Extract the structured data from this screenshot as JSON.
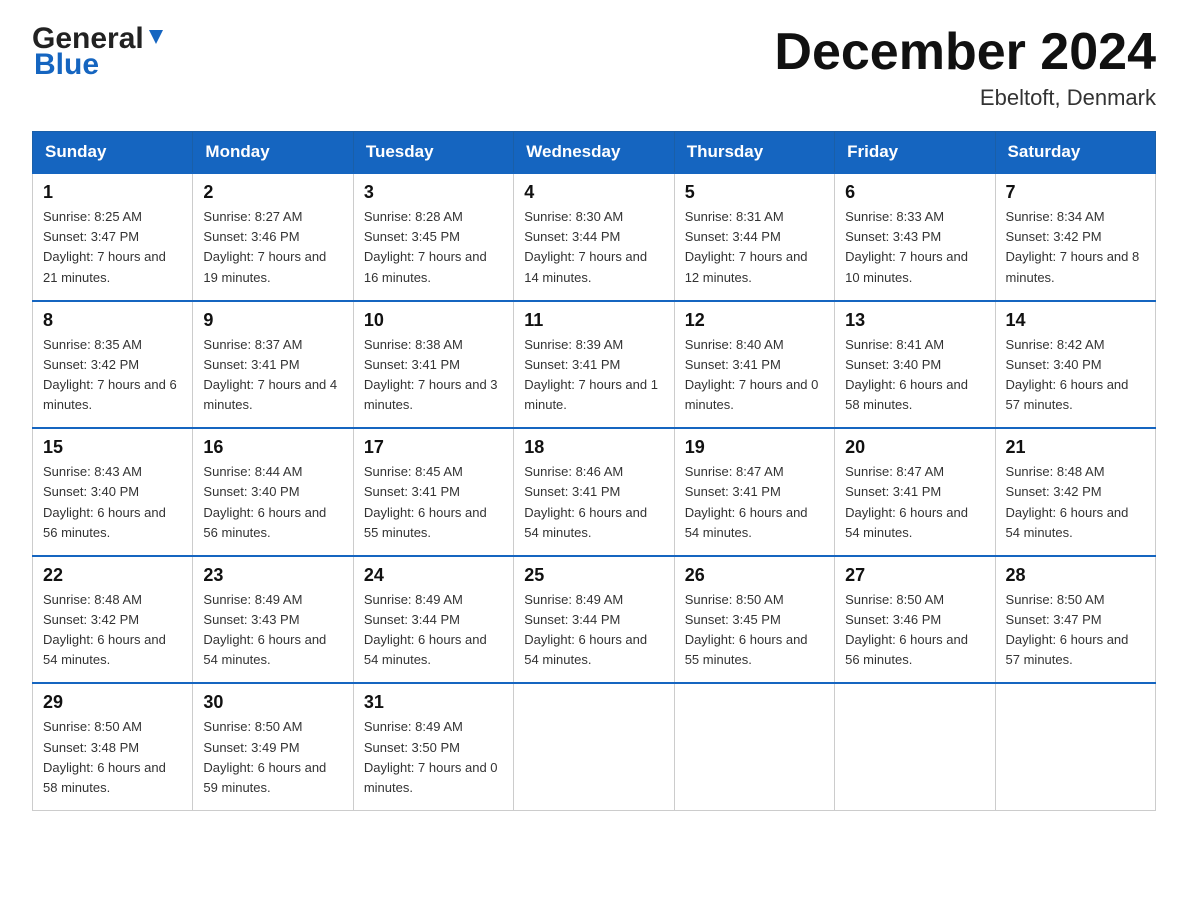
{
  "header": {
    "logo_general": "General",
    "logo_blue": "Blue",
    "title": "December 2024",
    "subtitle": "Ebeltoft, Denmark"
  },
  "calendar": {
    "days_of_week": [
      "Sunday",
      "Monday",
      "Tuesday",
      "Wednesday",
      "Thursday",
      "Friday",
      "Saturday"
    ],
    "weeks": [
      [
        {
          "day": "1",
          "sunrise": "8:25 AM",
          "sunset": "3:47 PM",
          "daylight": "7 hours and 21 minutes."
        },
        {
          "day": "2",
          "sunrise": "8:27 AM",
          "sunset": "3:46 PM",
          "daylight": "7 hours and 19 minutes."
        },
        {
          "day": "3",
          "sunrise": "8:28 AM",
          "sunset": "3:45 PM",
          "daylight": "7 hours and 16 minutes."
        },
        {
          "day": "4",
          "sunrise": "8:30 AM",
          "sunset": "3:44 PM",
          "daylight": "7 hours and 14 minutes."
        },
        {
          "day": "5",
          "sunrise": "8:31 AM",
          "sunset": "3:44 PM",
          "daylight": "7 hours and 12 minutes."
        },
        {
          "day": "6",
          "sunrise": "8:33 AM",
          "sunset": "3:43 PM",
          "daylight": "7 hours and 10 minutes."
        },
        {
          "day": "7",
          "sunrise": "8:34 AM",
          "sunset": "3:42 PM",
          "daylight": "7 hours and 8 minutes."
        }
      ],
      [
        {
          "day": "8",
          "sunrise": "8:35 AM",
          "sunset": "3:42 PM",
          "daylight": "7 hours and 6 minutes."
        },
        {
          "day": "9",
          "sunrise": "8:37 AM",
          "sunset": "3:41 PM",
          "daylight": "7 hours and 4 minutes."
        },
        {
          "day": "10",
          "sunrise": "8:38 AM",
          "sunset": "3:41 PM",
          "daylight": "7 hours and 3 minutes."
        },
        {
          "day": "11",
          "sunrise": "8:39 AM",
          "sunset": "3:41 PM",
          "daylight": "7 hours and 1 minute."
        },
        {
          "day": "12",
          "sunrise": "8:40 AM",
          "sunset": "3:41 PM",
          "daylight": "7 hours and 0 minutes."
        },
        {
          "day": "13",
          "sunrise": "8:41 AM",
          "sunset": "3:40 PM",
          "daylight": "6 hours and 58 minutes."
        },
        {
          "day": "14",
          "sunrise": "8:42 AM",
          "sunset": "3:40 PM",
          "daylight": "6 hours and 57 minutes."
        }
      ],
      [
        {
          "day": "15",
          "sunrise": "8:43 AM",
          "sunset": "3:40 PM",
          "daylight": "6 hours and 56 minutes."
        },
        {
          "day": "16",
          "sunrise": "8:44 AM",
          "sunset": "3:40 PM",
          "daylight": "6 hours and 56 minutes."
        },
        {
          "day": "17",
          "sunrise": "8:45 AM",
          "sunset": "3:41 PM",
          "daylight": "6 hours and 55 minutes."
        },
        {
          "day": "18",
          "sunrise": "8:46 AM",
          "sunset": "3:41 PM",
          "daylight": "6 hours and 54 minutes."
        },
        {
          "day": "19",
          "sunrise": "8:47 AM",
          "sunset": "3:41 PM",
          "daylight": "6 hours and 54 minutes."
        },
        {
          "day": "20",
          "sunrise": "8:47 AM",
          "sunset": "3:41 PM",
          "daylight": "6 hours and 54 minutes."
        },
        {
          "day": "21",
          "sunrise": "8:48 AM",
          "sunset": "3:42 PM",
          "daylight": "6 hours and 54 minutes."
        }
      ],
      [
        {
          "day": "22",
          "sunrise": "8:48 AM",
          "sunset": "3:42 PM",
          "daylight": "6 hours and 54 minutes."
        },
        {
          "day": "23",
          "sunrise": "8:49 AM",
          "sunset": "3:43 PM",
          "daylight": "6 hours and 54 minutes."
        },
        {
          "day": "24",
          "sunrise": "8:49 AM",
          "sunset": "3:44 PM",
          "daylight": "6 hours and 54 minutes."
        },
        {
          "day": "25",
          "sunrise": "8:49 AM",
          "sunset": "3:44 PM",
          "daylight": "6 hours and 54 minutes."
        },
        {
          "day": "26",
          "sunrise": "8:50 AM",
          "sunset": "3:45 PM",
          "daylight": "6 hours and 55 minutes."
        },
        {
          "day": "27",
          "sunrise": "8:50 AM",
          "sunset": "3:46 PM",
          "daylight": "6 hours and 56 minutes."
        },
        {
          "day": "28",
          "sunrise": "8:50 AM",
          "sunset": "3:47 PM",
          "daylight": "6 hours and 57 minutes."
        }
      ],
      [
        {
          "day": "29",
          "sunrise": "8:50 AM",
          "sunset": "3:48 PM",
          "daylight": "6 hours and 58 minutes."
        },
        {
          "day": "30",
          "sunrise": "8:50 AM",
          "sunset": "3:49 PM",
          "daylight": "6 hours and 59 minutes."
        },
        {
          "day": "31",
          "sunrise": "8:49 AM",
          "sunset": "3:50 PM",
          "daylight": "7 hours and 0 minutes."
        },
        null,
        null,
        null,
        null
      ]
    ]
  }
}
